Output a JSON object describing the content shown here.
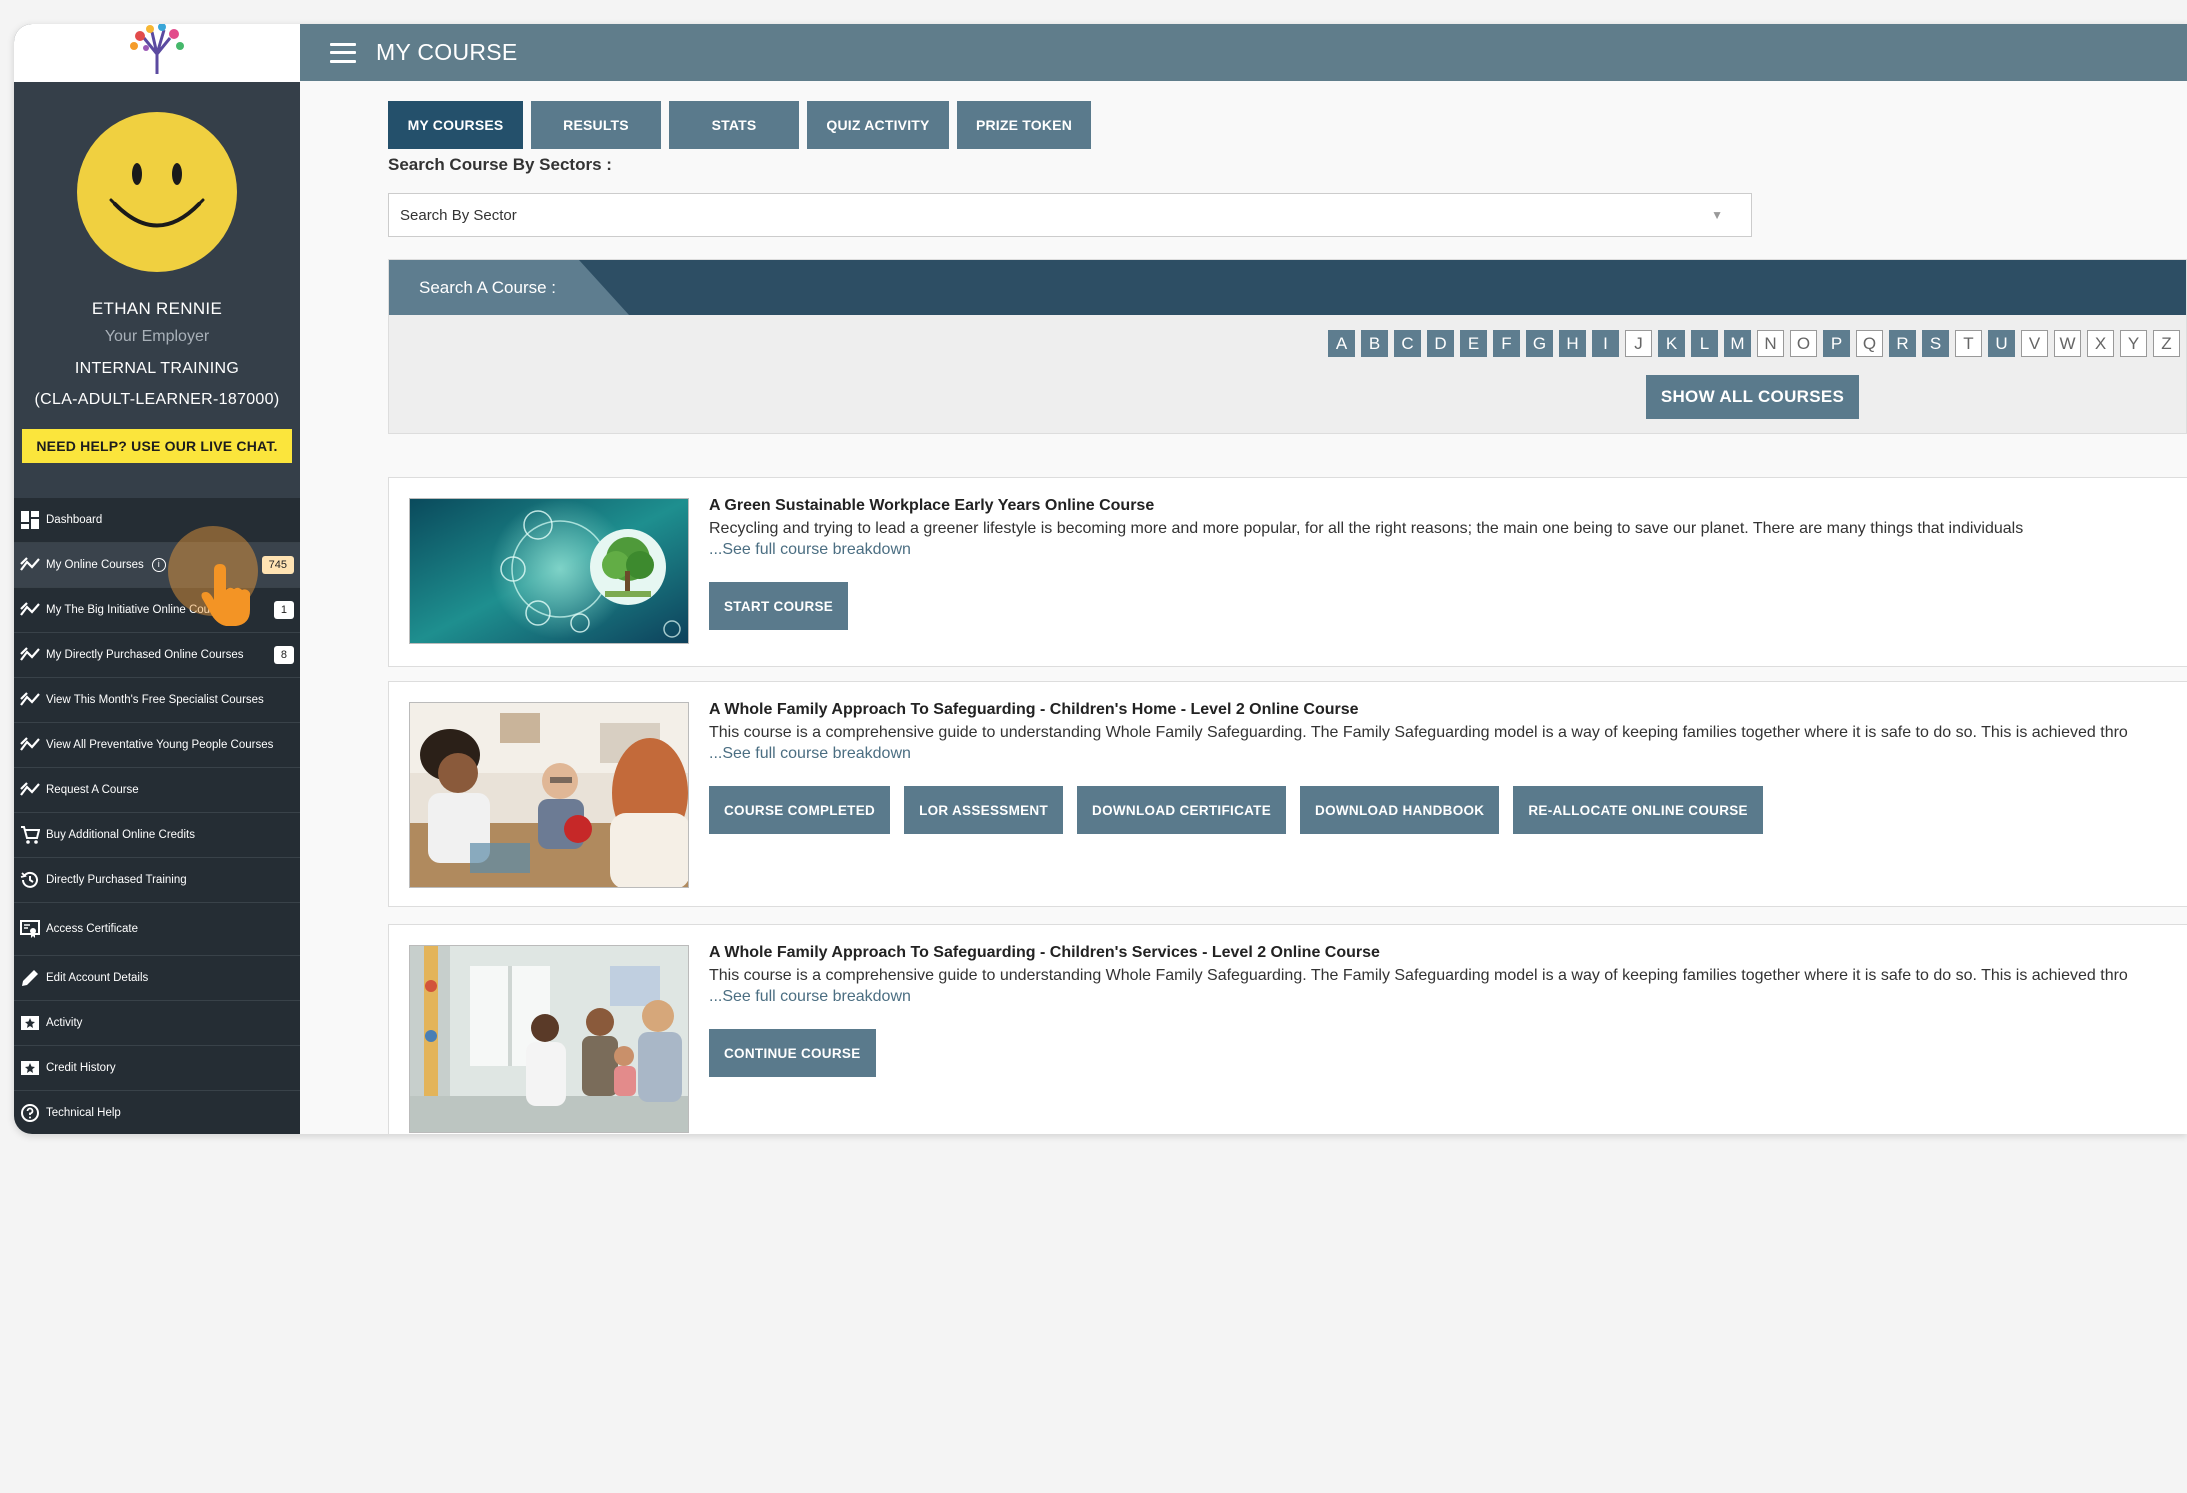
{
  "header": {
    "title": "MY COURSE"
  },
  "profile": {
    "name": "ETHAN RENNIE",
    "employer": "Your Employer",
    "training": "INTERNAL TRAINING",
    "id": "(CLA-ADULT-LEARNER-187000)",
    "help_label": "NEED HELP? USE OUR LIVE CHAT."
  },
  "sidebar": {
    "items": [
      {
        "label": "Dashboard",
        "icon": "dashboard-icon"
      },
      {
        "label": "My Online Courses",
        "icon": "trend-icon",
        "badge": "745"
      },
      {
        "label": "My The Big Initiative Online Courses",
        "icon": "trend-icon",
        "badge": "1"
      },
      {
        "label": "My Directly Purchased Online Courses",
        "icon": "trend-icon",
        "badge": "8"
      },
      {
        "label": "View This Month's Free Specialist Courses",
        "icon": "trend-icon"
      },
      {
        "label": "View All Preventative Young People Courses",
        "icon": "trend-icon"
      },
      {
        "label": "Request A Course",
        "icon": "trend-icon"
      },
      {
        "label": "Buy Additional Online Credits",
        "icon": "cart-icon"
      },
      {
        "label": "Directly Purchased Training",
        "icon": "history-icon"
      },
      {
        "label": "Access Certificate",
        "icon": "certificate-icon"
      },
      {
        "label": "Edit Account Details",
        "icon": "pencil-icon"
      },
      {
        "label": "Activity",
        "icon": "star-ticket-icon"
      },
      {
        "label": "Credit History",
        "icon": "star-ticket-icon"
      },
      {
        "label": "Technical Help",
        "icon": "help-icon"
      }
    ]
  },
  "tabs": [
    "MY COURSES",
    "RESULTS",
    "STATS",
    "QUIZ ACTIVITY",
    "PRIZE TOKEN"
  ],
  "search": {
    "sector_label": "Search Course By Sectors :",
    "sector_placeholder": "Search By Sector",
    "course_label": "Search A Course :",
    "letters": [
      "A",
      "B",
      "C",
      "D",
      "E",
      "F",
      "G",
      "H",
      "I",
      "J",
      "K",
      "L",
      "M",
      "N",
      "O",
      "P",
      "Q",
      "R",
      "S",
      "T",
      "U",
      "V",
      "W",
      "X",
      "Y",
      "Z"
    ],
    "inactive_letters": [
      "J",
      "N",
      "O",
      "Q",
      "T",
      "V",
      "W",
      "X",
      "Y",
      "Z"
    ],
    "show_all_label": "SHOW ALL COURSES"
  },
  "courses": [
    {
      "title": "A Green Sustainable Workplace Early Years Online Course",
      "description": "Recycling and trying to lead a greener lifestyle is becoming more and more popular, for all the right reasons; the main one being to save our planet. There are many things that individuals",
      "more": "...See full course breakdown",
      "buttons": [
        "START COURSE"
      ]
    },
    {
      "title": "A Whole Family Approach To Safeguarding - Children's Home - Level 2 Online Course",
      "description": "This course is a comprehensive guide to understanding Whole Family Safeguarding. The Family Safeguarding model is a way of keeping families together where it is safe to do so. This is achieved thro",
      "more": "...See full course breakdown",
      "buttons": [
        "COURSE COMPLETED",
        "LOR ASSESSMENT",
        "DOWNLOAD CERTIFICATE",
        "DOWNLOAD HANDBOOK",
        "RE-ALLOCATE ONLINE COURSE"
      ]
    },
    {
      "title": "A Whole Family Approach To Safeguarding - Children's Services - Level 2 Online Course",
      "description": "This course is a comprehensive guide to understanding Whole Family Safeguarding. The Family Safeguarding model is a way of keeping families together where it is safe to do so. This is achieved thro",
      "more": "...See full course breakdown",
      "buttons": [
        "CONTINUE COURSE"
      ]
    }
  ],
  "colors": {
    "topbar": "#607d8b",
    "sidebar": "#252d34",
    "button": "#5a7a8c",
    "active_tab": "#24506b",
    "help": "#fbe53c"
  }
}
